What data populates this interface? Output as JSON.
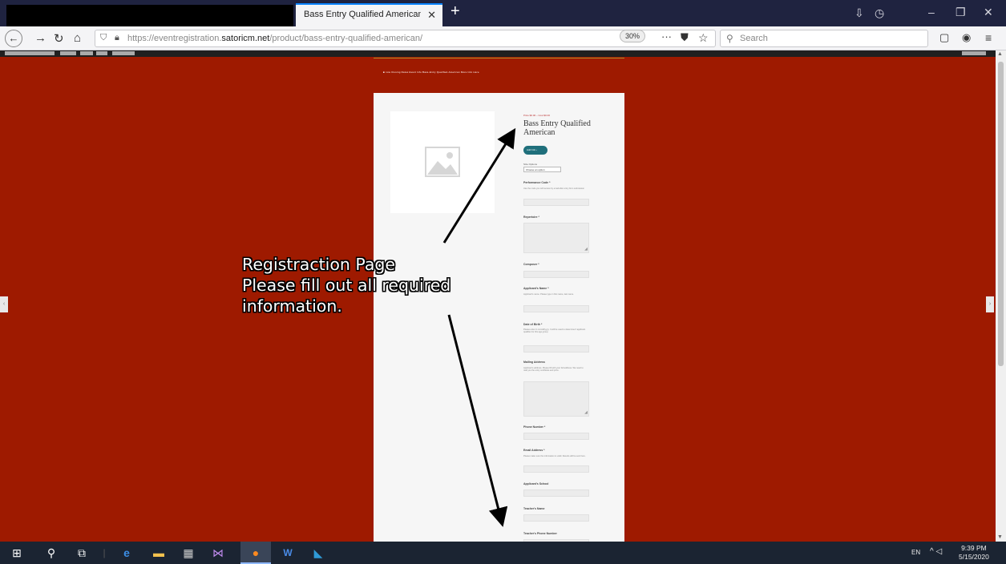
{
  "browser": {
    "tab_title": "Bass Entry Qualified American – Sat",
    "tab_close": "✕",
    "new_tab": "+",
    "url_prefix": "https://eventregistration.",
    "url_domain": "satoricm.net",
    "url_path": "/product/bass-entry-qualified-american/",
    "zoom": "30%",
    "menu_dots": "···",
    "search_placeholder": "Search"
  },
  "page": {
    "announcement": "■ now   Closing Dates   Event   Info   Bass-Entry   Qualified-American   More   Info   Here",
    "price": "Price $0.00 – Cost $0.00",
    "product_title": "Bass Entry Qualified American",
    "size_button": "Add Info ›",
    "option_label": "Size Options",
    "option_selected": "Choose an option",
    "fields": [
      {
        "label": "Performance Code *",
        "help": "Use the code you will receive by email after entry form submission"
      },
      {
        "label": "Repertoire *",
        "help": ""
      },
      {
        "label": "Composer *",
        "help": ""
      },
      {
        "label": "Applicant's Name *",
        "help": "Applicant's name. Please type in first name, last name."
      },
      {
        "label": "Date of Birth *",
        "help": "Please enter in mm/dd/yyyy. It will be used to determine if applicant qualifies for this age group."
      },
      {
        "label": "Mailing Address",
        "help": "Applicant's address. Please fill with your full address. We need to mail you the entry certificate and prize."
      },
      {
        "label": "Phone Number *",
        "help": ""
      },
      {
        "label": "Email Address *",
        "help": "Please make sure the information is valid. Results will be sent here."
      },
      {
        "label": "Applicant's School",
        "help": ""
      },
      {
        "label": "Teacher's Name",
        "help": ""
      },
      {
        "label": "Teacher's Phone Number",
        "help": ""
      }
    ]
  },
  "annotation": {
    "line1": "Registraction Page",
    "line2": "Please fill out all required",
    "line3": "information."
  },
  "taskbar": {
    "language": "EN",
    "time": "9:39 PM",
    "date": "5/15/2020"
  },
  "colors": {
    "page_background": "#9e1a00",
    "accent_button": "#1f6f7b",
    "titlebar": "#1f2340"
  }
}
